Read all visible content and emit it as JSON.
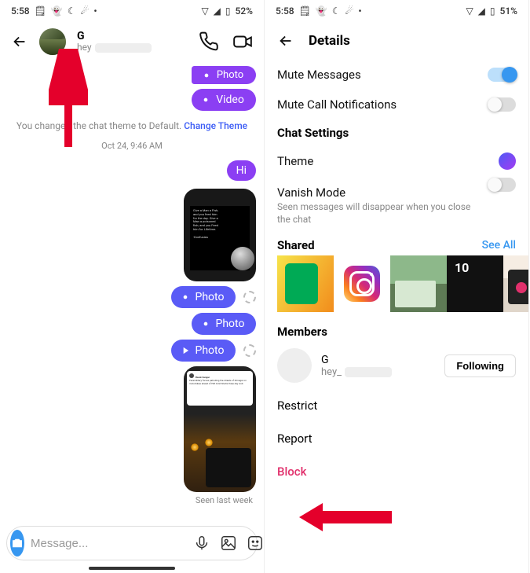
{
  "left": {
    "status": {
      "time": "5:58",
      "battery": "52%"
    },
    "contact": {
      "name": "G",
      "handle_prefix": "hey"
    },
    "pills": {
      "photo_label": "Photo",
      "video_label": "Video"
    },
    "system_text": {
      "prefix": "You changed the chat theme to Default. ",
      "link": "Change Theme"
    },
    "timestamp": "Oct 24, 9:46 AM",
    "hi": "Hi",
    "quote": {
      "l1": "Give a Man a Fish,",
      "l2": "and you feed him",
      "l3": "for the day. Give a",
      "l4": "Man a poisoned",
      "l5": "fish, and you Feed",
      "l6": "him for Lifetime.",
      "author": "-Konfusias"
    },
    "news": "Paramilitary forces patrolling the streets of Srinagar on motorbikes ahead of HM Amit Shah's three day visit.",
    "seen": "Seen last week",
    "composer_placeholder": "Message..."
  },
  "right": {
    "status": {
      "time": "5:58",
      "battery": "51%"
    },
    "title": "Details",
    "mute_messages": "Mute Messages",
    "mute_calls": "Mute Call Notifications",
    "chat_settings": "Chat Settings",
    "theme": "Theme",
    "vanish_title": "Vanish Mode",
    "vanish_desc": "Seen messages will disappear when you close the chat",
    "shared": "Shared",
    "see_all": "See All",
    "members": "Members",
    "member": {
      "name": "G",
      "handle_prefix": "hey_"
    },
    "following": "Following",
    "restrict": "Restrict",
    "report": "Report",
    "block": "Block"
  }
}
